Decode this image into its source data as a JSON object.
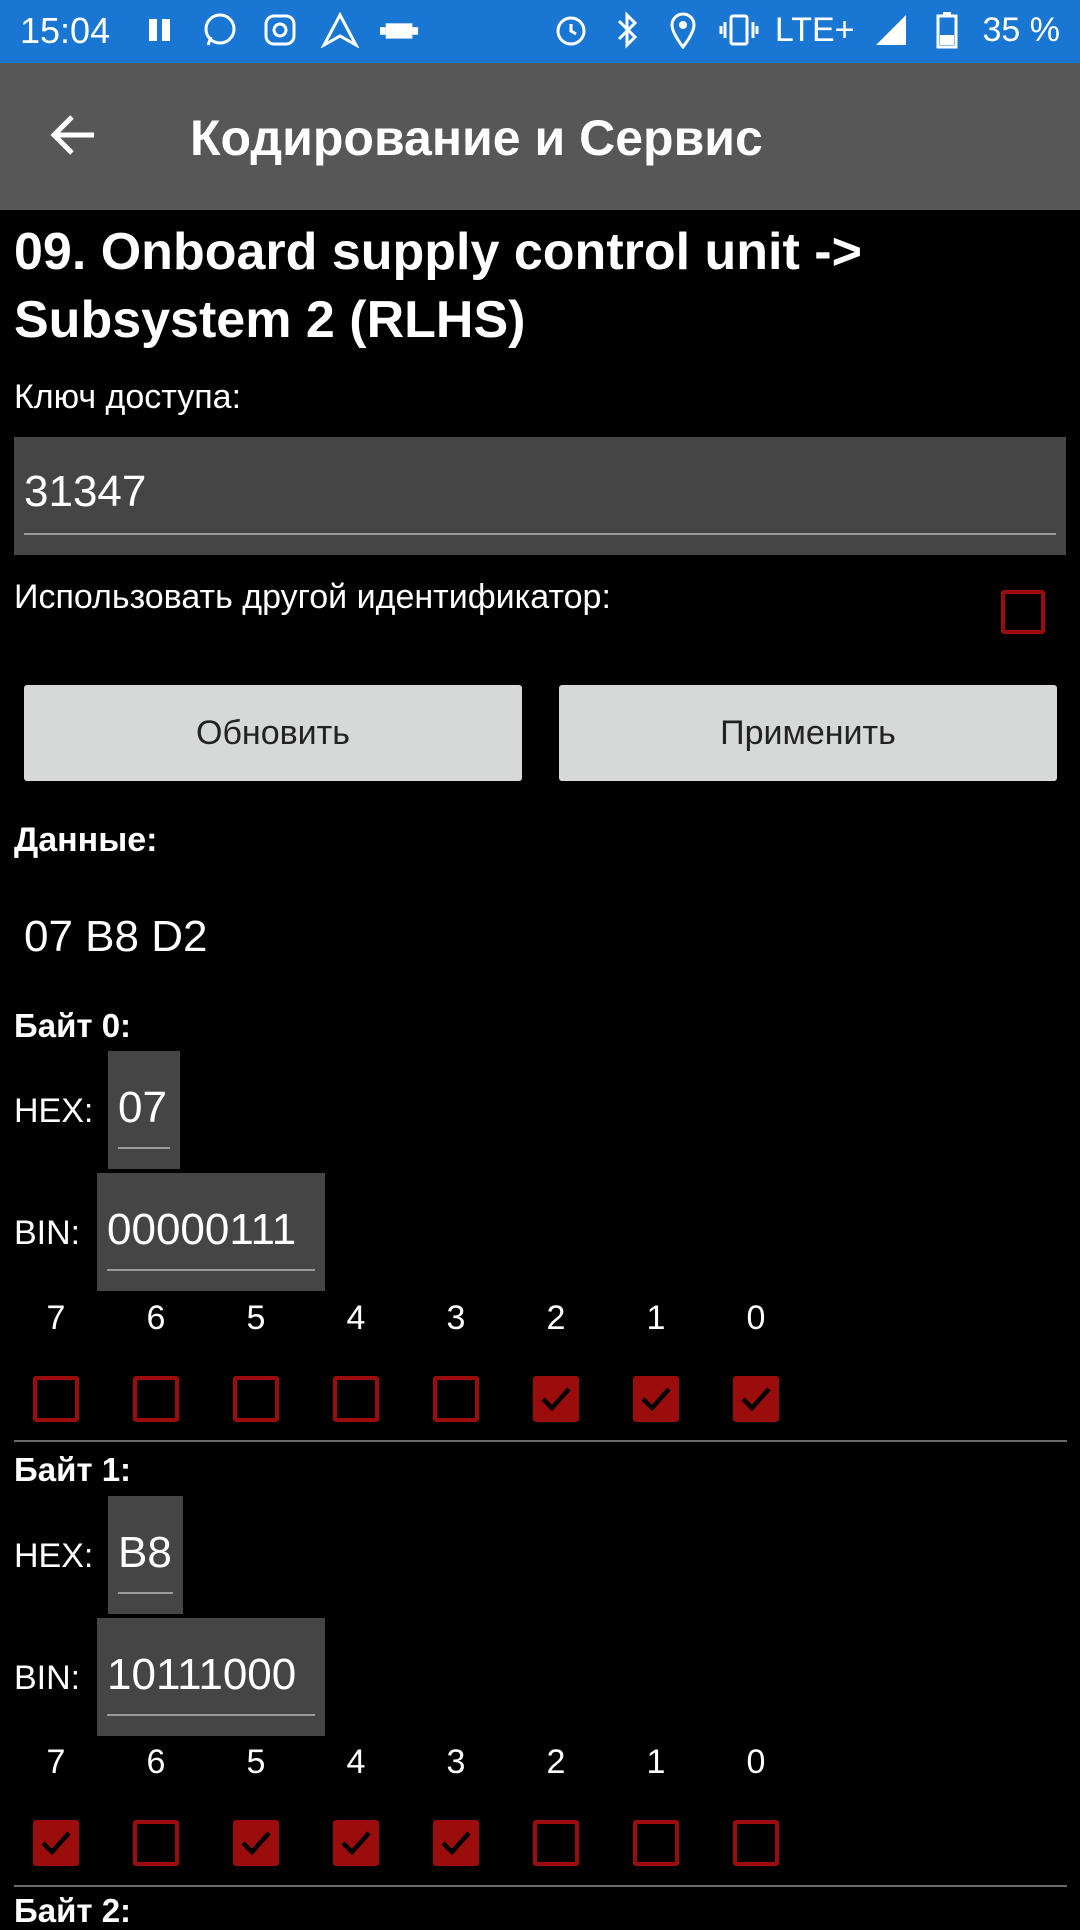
{
  "status_bar": {
    "time": "15:04",
    "network": "LTE+",
    "battery": "35 %",
    "background_color": "#1976d2",
    "left_icons": [
      "pause-icon",
      "whatsapp-icon",
      "instagram-icon",
      "nav-arrow-icon",
      "car-engine-icon"
    ],
    "right_icons": [
      "alarm-icon",
      "bluetooth-icon",
      "location-icon",
      "vibrate-icon",
      "signal-icon",
      "battery-icon"
    ]
  },
  "app_bar": {
    "title": "Кодирование и Сервис"
  },
  "module": {
    "title": "09. Onboard supply control unit -> Subsystem 2 (RLHS)"
  },
  "access_key": {
    "label": "Ключ доступа:",
    "value": "31347"
  },
  "other_id": {
    "label": "Использовать другой идентификатор:",
    "checked": false
  },
  "buttons": {
    "refresh": "Обновить",
    "apply": "Применить"
  },
  "data": {
    "label": "Данные:",
    "value": "07 B8 D2"
  },
  "bytes": [
    {
      "label": "Байт 0:",
      "hex_label": "HEX:",
      "hex": "07",
      "bin_label": "BIN:",
      "bin": "00000111",
      "bit_numbers": [
        "7",
        "6",
        "5",
        "4",
        "3",
        "2",
        "1",
        "0"
      ],
      "bits": [
        false,
        false,
        false,
        false,
        false,
        true,
        true,
        true
      ]
    },
    {
      "label": "Байт 1:",
      "hex_label": "HEX:",
      "hex": "B8",
      "bin_label": "BIN:",
      "bin": "10111000",
      "bit_numbers": [
        "7",
        "6",
        "5",
        "4",
        "3",
        "2",
        "1",
        "0"
      ],
      "bits": [
        true,
        false,
        true,
        true,
        true,
        false,
        false,
        false
      ]
    },
    {
      "label": "Байт 2:"
    }
  ],
  "colors": {
    "accent": "#9b0d0d",
    "appbar": "#575757",
    "field": "#454545",
    "button": "#d7d8d8"
  }
}
